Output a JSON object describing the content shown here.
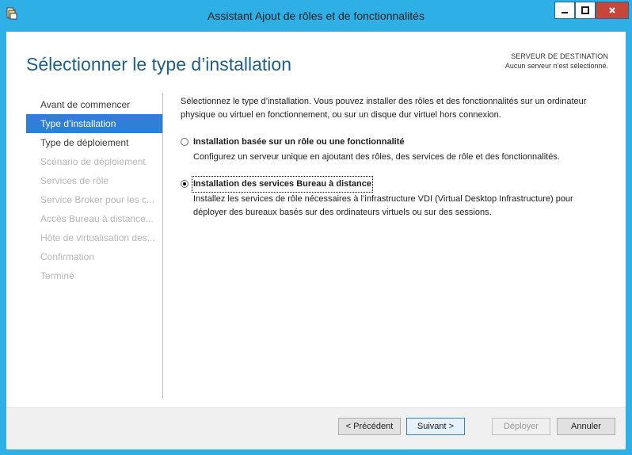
{
  "window": {
    "title": "Assistant Ajout de rôles et de fonctionnalités",
    "accent": "#2eb0e6",
    "min_icon": "minimize-icon",
    "max_icon": "maximize-icon",
    "close_icon": "close-icon"
  },
  "header": {
    "title": "Sélectionner le type d’installation",
    "destination_label": "SERVEUR DE DESTINATION",
    "destination_value": "Aucun serveur n’est sélectionné."
  },
  "nav": {
    "items": [
      {
        "label": "Avant de commencer",
        "state": "normal"
      },
      {
        "label": "Type d’installation",
        "state": "selected"
      },
      {
        "label": "Type de déploiement",
        "state": "normal"
      },
      {
        "label": "Scénario de déploiement",
        "state": "disabled"
      },
      {
        "label": "Services de rôle",
        "state": "disabled"
      },
      {
        "label": "Service Broker pour les c...",
        "state": "disabled"
      },
      {
        "label": "Accès Bureau à distance...",
        "state": "disabled"
      },
      {
        "label": "Hôte de virtualisation des...",
        "state": "disabled"
      },
      {
        "label": "Confirmation",
        "state": "disabled"
      },
      {
        "label": "Terminé",
        "state": "disabled"
      }
    ]
  },
  "main": {
    "intro": "Sélectionnez le type d’installation. Vous pouvez installer des rôles et des fonctionnalités sur un ordinateur physique ou virtuel en fonctionnement, ou sur un disque dur virtuel hors connexion.",
    "options": [
      {
        "label": "Installation basée sur un rôle ou une fonctionnalité",
        "description": "Configurez un serveur unique en ajoutant des rôles, des services de rôle et des fonctionnalités.",
        "checked": false
      },
      {
        "label": "Installation des services Bureau à distance",
        "description": "Installez les services de rôle nécessaires à l’infrastructure VDI (Virtual Desktop Infrastructure) pour déployer des bureaux basés sur des ordinateurs virtuels ou sur des sessions.",
        "checked": true
      }
    ]
  },
  "footer": {
    "previous": "< Précédent",
    "next": "Suivant >",
    "deploy": "Déployer",
    "cancel": "Annuler"
  }
}
